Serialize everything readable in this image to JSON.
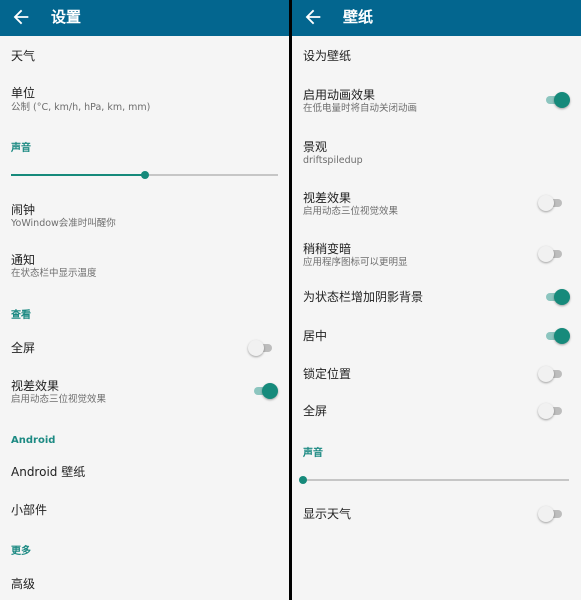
{
  "left": {
    "title": "设置",
    "back_icon": "arrow-left-icon",
    "weather": "天气",
    "units": {
      "label": "单位",
      "value": "公制 (°C, km/h, hPa, km, mm)"
    },
    "sound_section": "声音",
    "volume": 0.5,
    "alarm": {
      "label": "闹钟",
      "sub": "YoWindow会准时叫醒你"
    },
    "notification": {
      "label": "通知",
      "sub": "在状态栏中显示温度"
    },
    "view_section": "查看",
    "fullscreen": {
      "label": "全屏",
      "on": false
    },
    "parallax": {
      "label": "视差效果",
      "sub": "启用动态三位视觉效果",
      "on": true
    },
    "android_section": "Android",
    "android_wallpaper": "Android 壁纸",
    "widgets": "小部件",
    "more_section": "更多",
    "advanced": "高级"
  },
  "right": {
    "title": "壁纸",
    "back_icon": "arrow-left-icon",
    "set_wallpaper": "设为壁纸",
    "animation": {
      "label": "启用动画效果",
      "sub": "在低电量时将自动关闭动画",
      "on": true
    },
    "landscape": {
      "label": "景观",
      "value": "driftspiledup"
    },
    "parallax": {
      "label": "视差效果",
      "sub": "启用动态三位视觉效果",
      "on": false
    },
    "dim": {
      "label": "稍稍变暗",
      "sub": "应用程序图标可以更明显",
      "on": false
    },
    "statusbar_shadow": {
      "label": "为状态栏增加阴影背景",
      "on": true
    },
    "centered": {
      "label": "居中",
      "on": true
    },
    "lock_position": {
      "label": "锁定位置",
      "on": false
    },
    "fullscreen": {
      "label": "全屏",
      "on": false
    },
    "sound_section": "声音",
    "volume": 0.0,
    "show_weather": {
      "label": "显示天气",
      "on": false
    }
  },
  "colors": {
    "appbar": "#03668f",
    "accent": "#168a7b",
    "background": "#f5f5f5"
  }
}
